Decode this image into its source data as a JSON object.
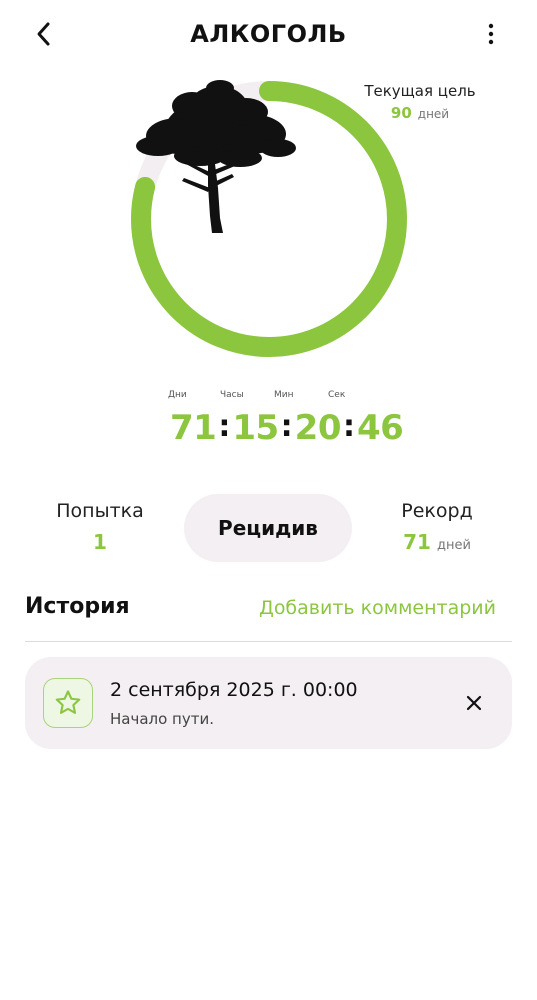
{
  "header": {
    "title": "АЛКОГОЛЬ",
    "back_icon": "chevron-left-icon",
    "menu_icon": "more-vertical-icon"
  },
  "goal": {
    "label": "Текущая цель",
    "value": "90",
    "unit": "дней"
  },
  "progress": {
    "fraction": 0.79,
    "color": "#8cc63f",
    "track_color": "#f3eef1"
  },
  "timer": {
    "labels": {
      "days": "Дни",
      "hours": "Часы",
      "minutes": "Мин",
      "seconds": "Сек"
    },
    "days": "71",
    "hours": "15",
    "minutes": "20",
    "seconds": "46",
    "separator": ":"
  },
  "stats": {
    "attempt_label": "Попытка",
    "attempt_value": "1",
    "relapse_label": "Рецидив",
    "record_label": "Рекорд",
    "record_value": "71",
    "record_unit": "дней"
  },
  "history": {
    "title": "История",
    "add_comment": "Добавить комментарий",
    "items": [
      {
        "icon": "star-icon",
        "date": "2 сентября 2025 г. 00:00",
        "note": "Начало пути."
      }
    ]
  },
  "colors": {
    "accent": "#8cc63f",
    "card_bg": "#f4eff2"
  }
}
